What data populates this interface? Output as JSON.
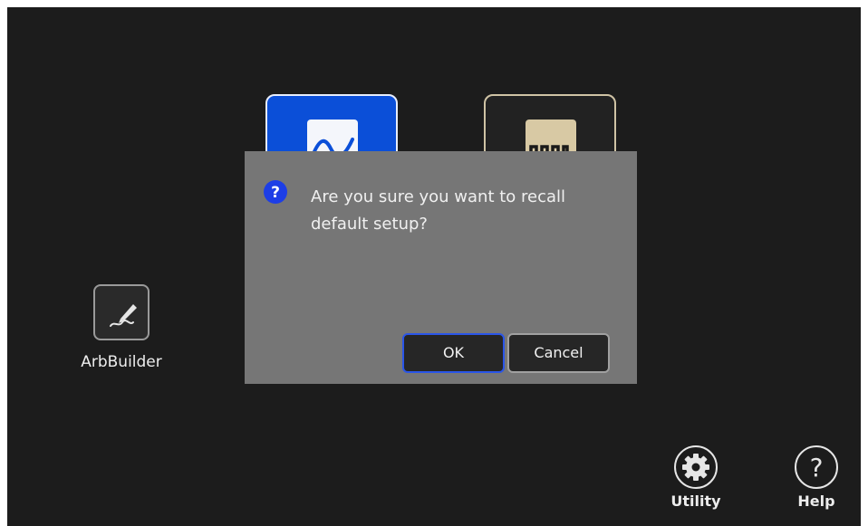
{
  "apps": {
    "function_generator_icon": "sine-wave-icon",
    "arbitrary_icon": "square-pulse-wave-icon",
    "arbbuilder": {
      "label": "ArbBuilder",
      "icon": "pen-signature-icon"
    }
  },
  "toolbar": {
    "utility_label": "Utility",
    "utility_icon": "gear-icon",
    "help_label": "Help",
    "help_icon": "question-circle-icon"
  },
  "dialog": {
    "icon": "question-icon",
    "message": "Are you sure you want to recall default setup?",
    "ok_label": "OK",
    "cancel_label": "Cancel"
  },
  "colors": {
    "background": "#1c1c1c",
    "dialog_background": "#767676",
    "accent_blue": "#0b4fd8",
    "arb_accent": "#d8c9a4",
    "focus_border": "#2a55e8"
  }
}
